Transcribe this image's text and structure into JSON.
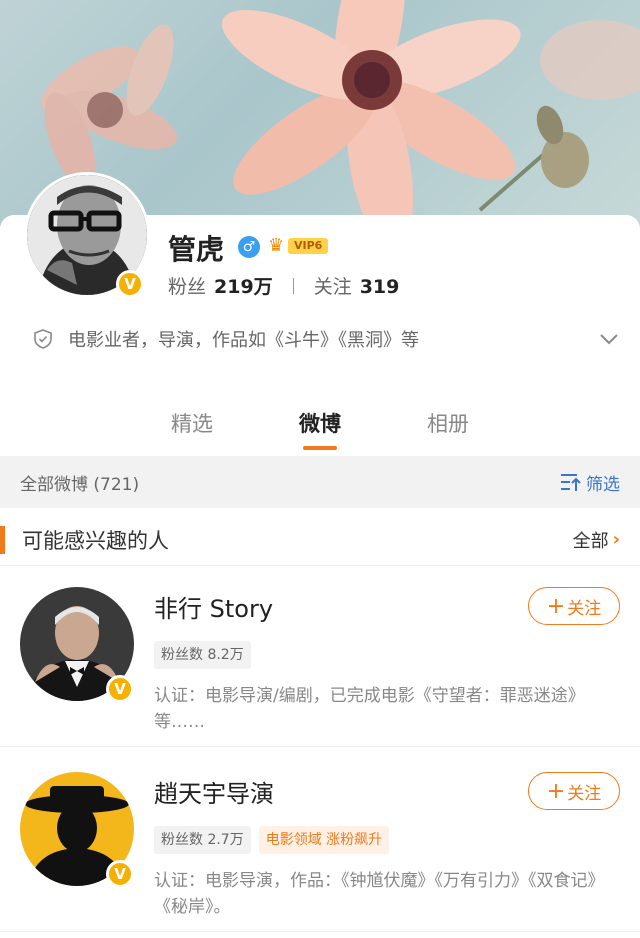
{
  "profile": {
    "name": "管虎",
    "gender_icon": "male-icon",
    "vip_label": "VIP6",
    "fans_label": "粉丝",
    "fans_count": "219万",
    "follow_label": "关注",
    "follow_count": "319",
    "bio": "电影业者，导演，作品如《斗牛》《黑洞》等",
    "verified_badge": "V"
  },
  "tabs": [
    {
      "label": "精选",
      "active": false
    },
    {
      "label": "微博",
      "active": true
    },
    {
      "label": "相册",
      "active": false
    }
  ],
  "filter": {
    "summary": "全部微博 (721)",
    "button_label": "筛选"
  },
  "recommend": {
    "title": "可能感兴趣的人",
    "all_label": "全部",
    "follow_label": "关注",
    "users": [
      {
        "name": "非行 Story",
        "tags": [
          "粉丝数 8.2万"
        ],
        "desc": "认证：电影导演/编剧，已完成电影《守望者：罪恶迷途》等……",
        "badge": "V"
      },
      {
        "name": "趙天宇导演",
        "tags": [
          "粉丝数 2.7万",
          "电影领域 涨粉飙升"
        ],
        "desc": "认证：电影导演，作品：《钟馗伏魔》《万有引力》《双食记》《秘岸》。",
        "badge": "V"
      }
    ]
  },
  "colors": {
    "accent": "#f27a1a",
    "link": "#3a76c9",
    "verified": "#f5b000"
  }
}
